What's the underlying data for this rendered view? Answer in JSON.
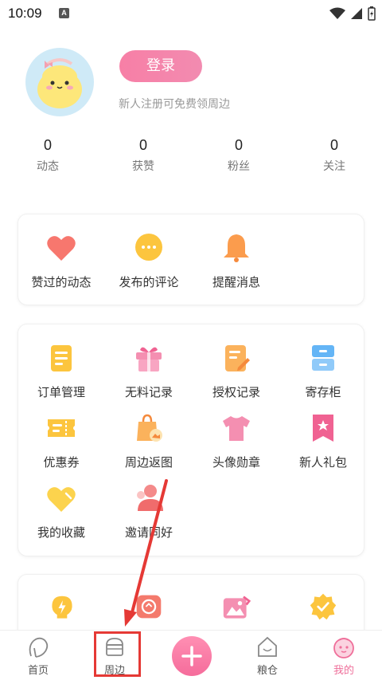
{
  "status_bar": {
    "time": "10:09",
    "notif_glyph": "A"
  },
  "profile": {
    "login_label": "登录",
    "subtitle": "新人注册可免费领周边"
  },
  "stats": [
    {
      "value": "0",
      "label": "动态"
    },
    {
      "value": "0",
      "label": "获赞"
    },
    {
      "value": "0",
      "label": "粉丝"
    },
    {
      "value": "0",
      "label": "关注"
    }
  ],
  "card1": {
    "items": [
      {
        "label": "赞过的动态",
        "icon": "heart-icon"
      },
      {
        "label": "发布的评论",
        "icon": "comment-icon"
      },
      {
        "label": "提醒消息",
        "icon": "bell-icon"
      }
    ]
  },
  "card2": {
    "items": [
      {
        "label": "订单管理",
        "icon": "order-icon"
      },
      {
        "label": "无料记录",
        "icon": "gift-icon"
      },
      {
        "label": "授权记录",
        "icon": "authorize-icon"
      },
      {
        "label": "寄存柜",
        "icon": "locker-icon"
      },
      {
        "label": "优惠券",
        "icon": "coupon-icon"
      },
      {
        "label": "周边返图",
        "icon": "merch-photo-icon"
      },
      {
        "label": "头像勋章",
        "icon": "tshirt-icon"
      },
      {
        "label": "新人礼包",
        "icon": "bookmark-star-icon"
      },
      {
        "label": "我的收藏",
        "icon": "favorite-icon"
      },
      {
        "label": "邀请同好",
        "icon": "invite-icon"
      }
    ]
  },
  "tabbar": {
    "items": [
      {
        "label": "首页",
        "icon": "home-icon"
      },
      {
        "label": "周边",
        "icon": "merch-icon"
      },
      {
        "label": "粮仓",
        "icon": "granary-icon"
      },
      {
        "label": "我的",
        "icon": "mine-icon"
      }
    ],
    "active": "我的"
  },
  "colors": {
    "accent": "#f77fa6",
    "annotation": "#e53935"
  }
}
